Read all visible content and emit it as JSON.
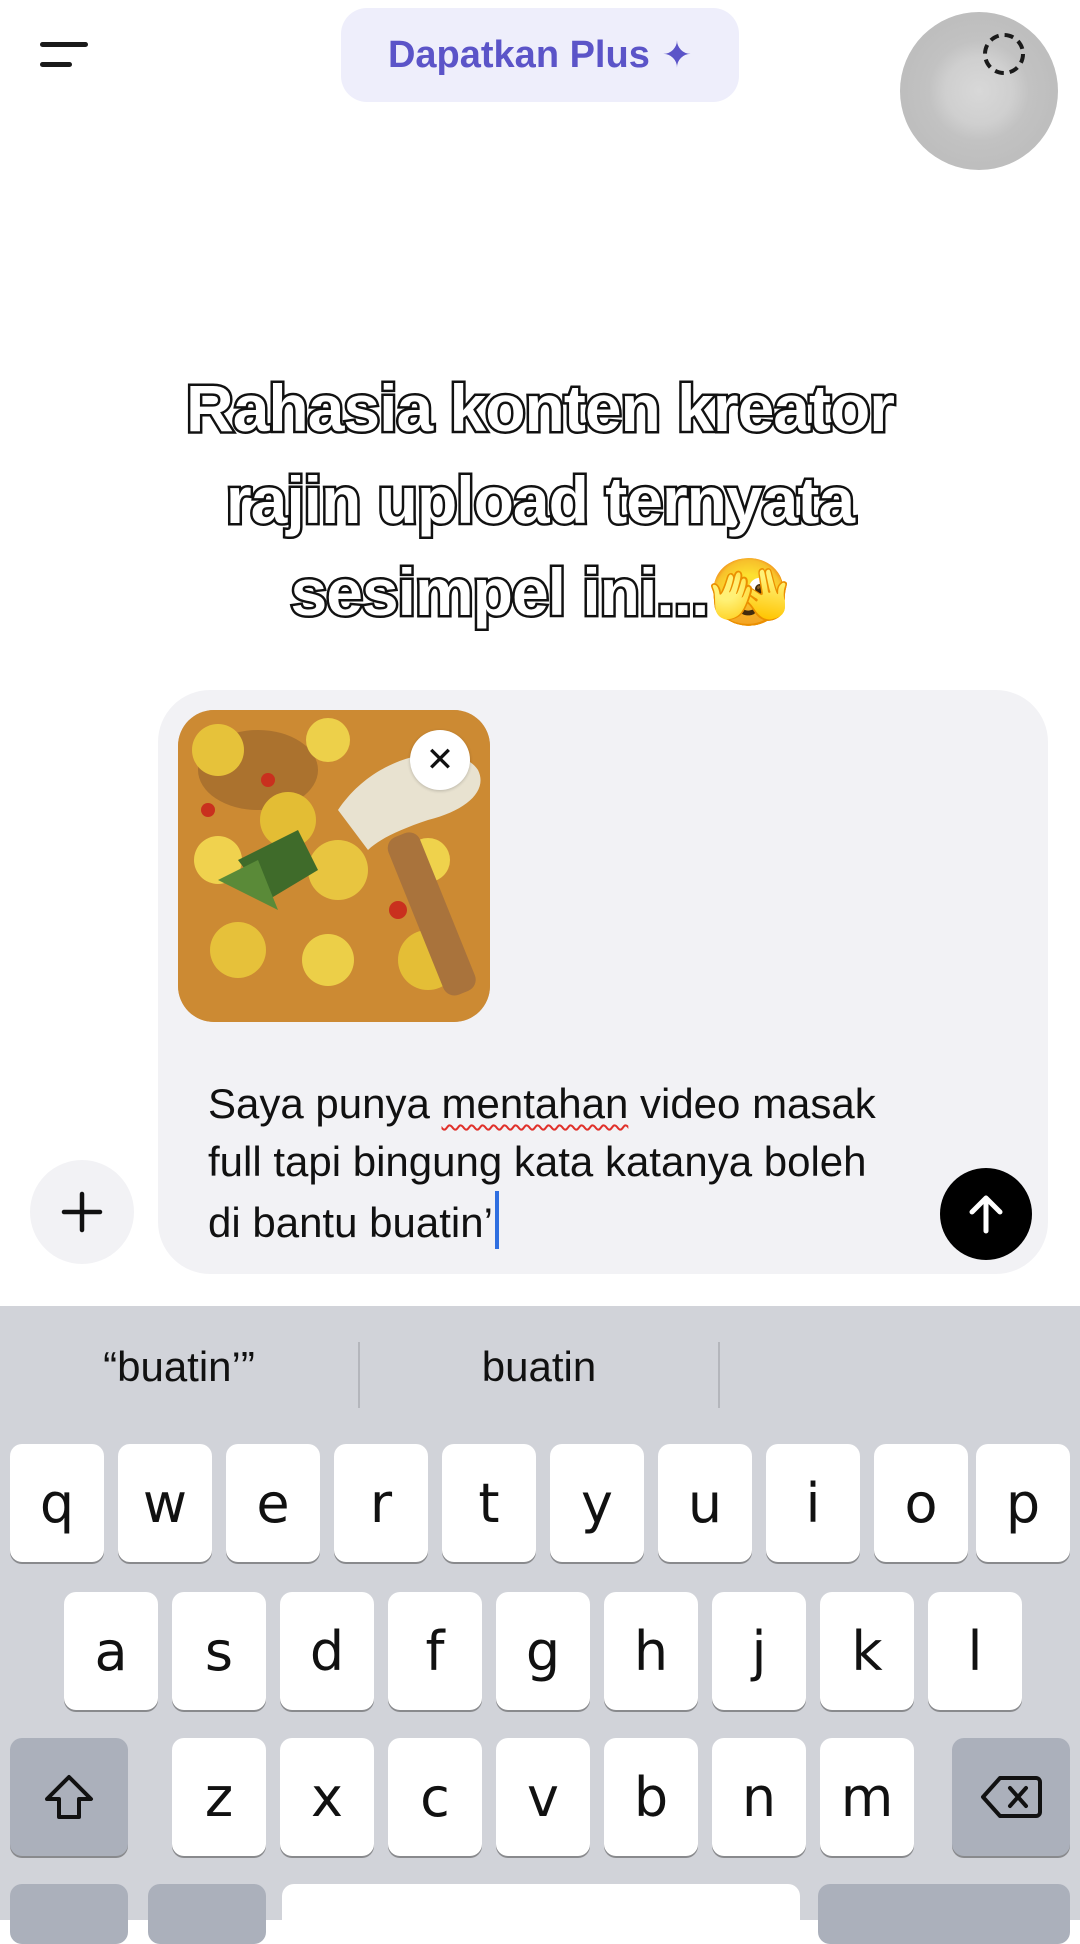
{
  "header": {
    "upgrade_label": "Dapatkan Plus",
    "upgrade_icon": "sparkle-icon",
    "accent_color": "#5b54c8"
  },
  "caption": {
    "line1": "Rahasia konten kreator",
    "line2": "rajin upload ternyata",
    "line3": "sesimpel ini...🫣"
  },
  "composer": {
    "attachment": "food-photo",
    "message_part1": "Saya punya ",
    "message_misspelled": "mentahan",
    "message_part2": " video masak full tapi bingung kata katanya boleh di bantu buatin’"
  },
  "keyboard": {
    "suggestions": [
      "“buatin’”",
      "buatin",
      ""
    ],
    "row1": [
      "q",
      "w",
      "e",
      "r",
      "t",
      "y",
      "u",
      "i",
      "o",
      "p"
    ],
    "row2": [
      "a",
      "s",
      "d",
      "f",
      "g",
      "h",
      "j",
      "k",
      "l"
    ],
    "row3": [
      "z",
      "x",
      "c",
      "v",
      "b",
      "n",
      "m"
    ],
    "shift_icon": "shift-icon",
    "delete_icon": "backspace-icon"
  }
}
